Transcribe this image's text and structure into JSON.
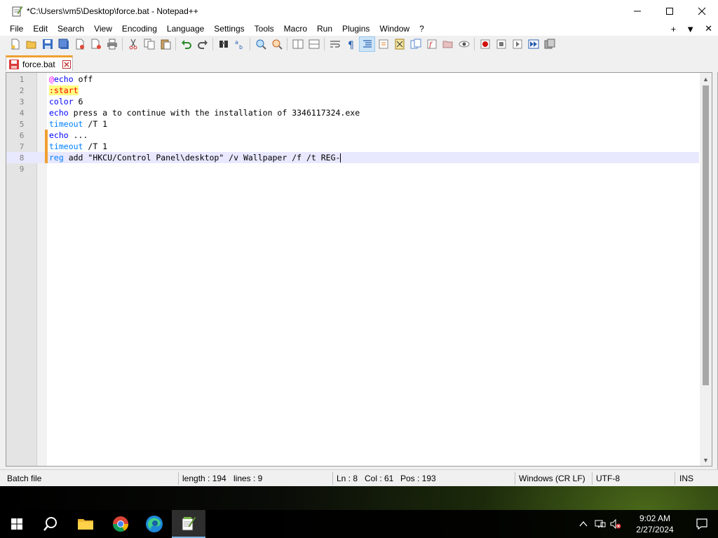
{
  "window": {
    "title": "*C:\\Users\\vm5\\Desktop\\force.bat - Notepad++"
  },
  "menu": {
    "items": [
      "File",
      "Edit",
      "Search",
      "View",
      "Encoding",
      "Language",
      "Settings",
      "Tools",
      "Macro",
      "Run",
      "Plugins",
      "Window",
      "?"
    ],
    "right_plus": "+",
    "right_dropdown": "▼",
    "right_close": "✕"
  },
  "tab": {
    "label": "force.bat"
  },
  "editor": {
    "lines": [
      {
        "num": "1",
        "text": "@echo off"
      },
      {
        "num": "2",
        "text": ":start"
      },
      {
        "num": "3",
        "text": "color 6"
      },
      {
        "num": "4",
        "text": "echo press a to continue with the installation of 3346117324.exe"
      },
      {
        "num": "5",
        "text": "timeout /T 1"
      },
      {
        "num": "6",
        "text": "echo ..."
      },
      {
        "num": "7",
        "text": "timeout /T 1"
      },
      {
        "num": "8",
        "text": "reg add \"HKCU/Control Panel\\desktop\" /v Wallpaper /f /t REG-"
      },
      {
        "num": "9",
        "text": ""
      }
    ]
  },
  "status": {
    "file_type": "Batch file",
    "length": "length : 194",
    "lines": "lines : 9",
    "ln": "Ln : 8",
    "col": "Col : 61",
    "pos": "Pos : 193",
    "eol": "Windows (CR LF)",
    "encoding": "UTF-8",
    "mode": "INS"
  },
  "taskbar": {
    "time": "9:02 AM",
    "date": "2/27/2024"
  },
  "colors": {
    "tab_accent": "#f0a030",
    "keyword": "#0000ff",
    "keyword2": "#0080ff",
    "label_bg": "#ffff80",
    "label_fg": "#ff0000"
  }
}
